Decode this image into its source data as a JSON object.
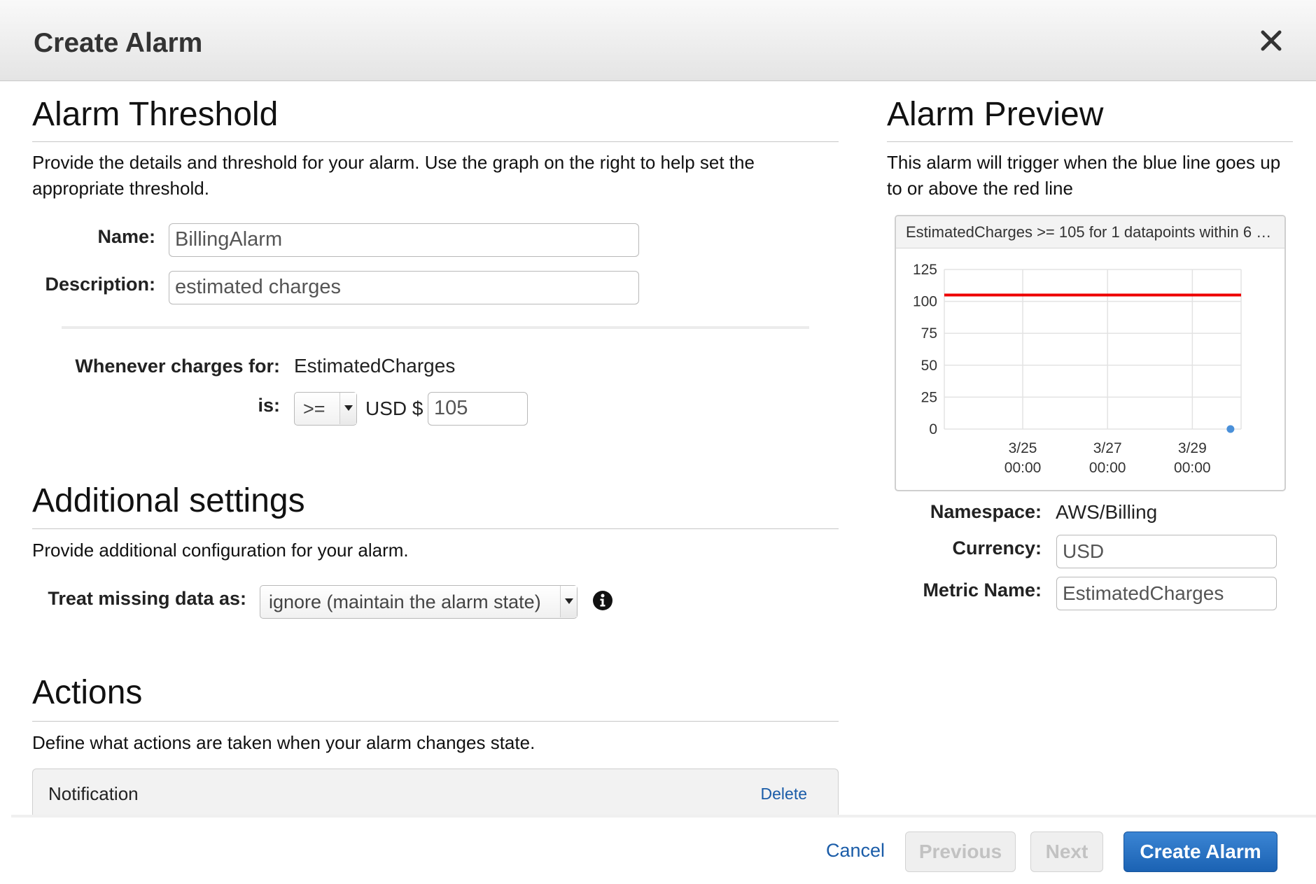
{
  "dialog": {
    "title": "Create Alarm"
  },
  "threshold": {
    "heading": "Alarm Threshold",
    "description": "Provide the details and threshold for your alarm. Use the graph on the right to help set the appropriate threshold.",
    "name_label": "Name:",
    "name_value": "BillingAlarm",
    "description_label": "Description:",
    "description_value": "estimated charges",
    "whenever_label": "Whenever charges for:",
    "whenever_value": "EstimatedCharges",
    "is_label": "is:",
    "operator": ">=",
    "currency_prefix": "USD $",
    "threshold_value": "105"
  },
  "additional": {
    "heading": "Additional settings",
    "description": "Provide additional configuration for your alarm.",
    "missing_label": "Treat missing data as:",
    "missing_value": "ignore (maintain the alarm state)"
  },
  "actions": {
    "heading": "Actions",
    "description": "Define what actions are taken when your alarm changes state.",
    "notification_title": "Notification",
    "delete_label": "Delete"
  },
  "preview": {
    "heading": "Alarm Preview",
    "description": "This alarm will trigger when the blue line goes up to or above the red line",
    "chart_title": "EstimatedCharges >= 105 for 1 datapoints within 6 h...",
    "namespace_label": "Namespace:",
    "namespace_value": "AWS/Billing",
    "currency_label": "Currency:",
    "currency_value": "USD",
    "metric_label": "Metric Name:",
    "metric_value": "EstimatedCharges"
  },
  "footer": {
    "cancel_label": "Cancel",
    "previous_label": "Previous",
    "next_label": "Next",
    "create_label": "Create Alarm"
  },
  "colors": {
    "threshold_line": "#ee0000",
    "metric_point": "#4a90d9",
    "primary_button": "#1f6bbf"
  },
  "chart_data": {
    "type": "line",
    "title": "EstimatedCharges >= 105 for 1 datapoints within 6 h...",
    "y_ticks": [
      0,
      25,
      50,
      75,
      100,
      125
    ],
    "ylim": [
      0,
      125
    ],
    "x_ticks": [
      {
        "date": "3/25",
        "time": "00:00",
        "day": 25
      },
      {
        "date": "3/27",
        "time": "00:00",
        "day": 27
      },
      {
        "date": "3/29",
        "time": "00:00",
        "day": 29
      }
    ],
    "xlim_days": [
      23.15,
      30.15
    ],
    "threshold": 105,
    "series": [
      {
        "points": [
          {
            "day": 29.9,
            "value": 0
          }
        ]
      }
    ],
    "grid": true
  }
}
